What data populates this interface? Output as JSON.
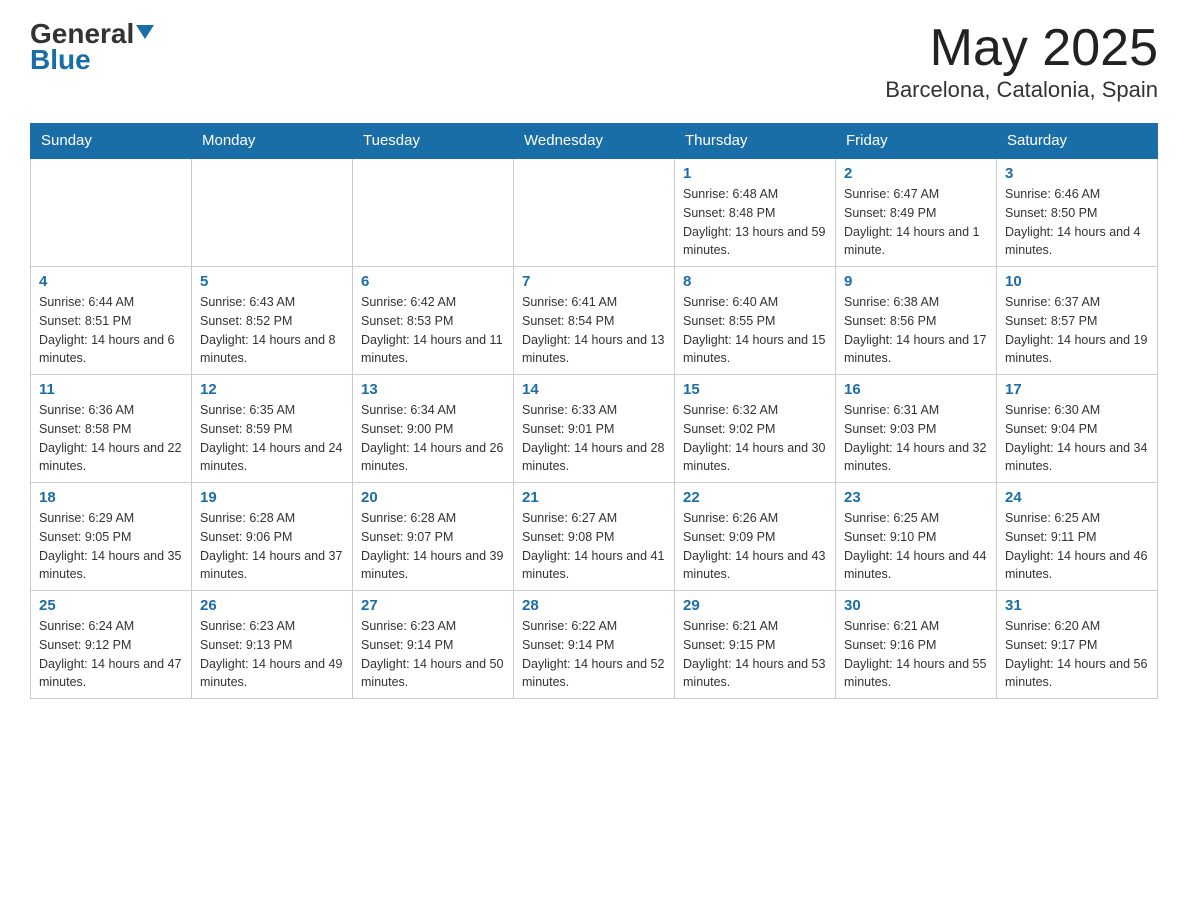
{
  "header": {
    "logo_general": "General",
    "logo_blue": "Blue",
    "title": "May 2025",
    "subtitle": "Barcelona, Catalonia, Spain"
  },
  "days_of_week": [
    "Sunday",
    "Monday",
    "Tuesday",
    "Wednesday",
    "Thursday",
    "Friday",
    "Saturday"
  ],
  "weeks": [
    [
      {
        "day": "",
        "info": ""
      },
      {
        "day": "",
        "info": ""
      },
      {
        "day": "",
        "info": ""
      },
      {
        "day": "",
        "info": ""
      },
      {
        "day": "1",
        "info": "Sunrise: 6:48 AM\nSunset: 8:48 PM\nDaylight: 13 hours and 59 minutes."
      },
      {
        "day": "2",
        "info": "Sunrise: 6:47 AM\nSunset: 8:49 PM\nDaylight: 14 hours and 1 minute."
      },
      {
        "day": "3",
        "info": "Sunrise: 6:46 AM\nSunset: 8:50 PM\nDaylight: 14 hours and 4 minutes."
      }
    ],
    [
      {
        "day": "4",
        "info": "Sunrise: 6:44 AM\nSunset: 8:51 PM\nDaylight: 14 hours and 6 minutes."
      },
      {
        "day": "5",
        "info": "Sunrise: 6:43 AM\nSunset: 8:52 PM\nDaylight: 14 hours and 8 minutes."
      },
      {
        "day": "6",
        "info": "Sunrise: 6:42 AM\nSunset: 8:53 PM\nDaylight: 14 hours and 11 minutes."
      },
      {
        "day": "7",
        "info": "Sunrise: 6:41 AM\nSunset: 8:54 PM\nDaylight: 14 hours and 13 minutes."
      },
      {
        "day": "8",
        "info": "Sunrise: 6:40 AM\nSunset: 8:55 PM\nDaylight: 14 hours and 15 minutes."
      },
      {
        "day": "9",
        "info": "Sunrise: 6:38 AM\nSunset: 8:56 PM\nDaylight: 14 hours and 17 minutes."
      },
      {
        "day": "10",
        "info": "Sunrise: 6:37 AM\nSunset: 8:57 PM\nDaylight: 14 hours and 19 minutes."
      }
    ],
    [
      {
        "day": "11",
        "info": "Sunrise: 6:36 AM\nSunset: 8:58 PM\nDaylight: 14 hours and 22 minutes."
      },
      {
        "day": "12",
        "info": "Sunrise: 6:35 AM\nSunset: 8:59 PM\nDaylight: 14 hours and 24 minutes."
      },
      {
        "day": "13",
        "info": "Sunrise: 6:34 AM\nSunset: 9:00 PM\nDaylight: 14 hours and 26 minutes."
      },
      {
        "day": "14",
        "info": "Sunrise: 6:33 AM\nSunset: 9:01 PM\nDaylight: 14 hours and 28 minutes."
      },
      {
        "day": "15",
        "info": "Sunrise: 6:32 AM\nSunset: 9:02 PM\nDaylight: 14 hours and 30 minutes."
      },
      {
        "day": "16",
        "info": "Sunrise: 6:31 AM\nSunset: 9:03 PM\nDaylight: 14 hours and 32 minutes."
      },
      {
        "day": "17",
        "info": "Sunrise: 6:30 AM\nSunset: 9:04 PM\nDaylight: 14 hours and 34 minutes."
      }
    ],
    [
      {
        "day": "18",
        "info": "Sunrise: 6:29 AM\nSunset: 9:05 PM\nDaylight: 14 hours and 35 minutes."
      },
      {
        "day": "19",
        "info": "Sunrise: 6:28 AM\nSunset: 9:06 PM\nDaylight: 14 hours and 37 minutes."
      },
      {
        "day": "20",
        "info": "Sunrise: 6:28 AM\nSunset: 9:07 PM\nDaylight: 14 hours and 39 minutes."
      },
      {
        "day": "21",
        "info": "Sunrise: 6:27 AM\nSunset: 9:08 PM\nDaylight: 14 hours and 41 minutes."
      },
      {
        "day": "22",
        "info": "Sunrise: 6:26 AM\nSunset: 9:09 PM\nDaylight: 14 hours and 43 minutes."
      },
      {
        "day": "23",
        "info": "Sunrise: 6:25 AM\nSunset: 9:10 PM\nDaylight: 14 hours and 44 minutes."
      },
      {
        "day": "24",
        "info": "Sunrise: 6:25 AM\nSunset: 9:11 PM\nDaylight: 14 hours and 46 minutes."
      }
    ],
    [
      {
        "day": "25",
        "info": "Sunrise: 6:24 AM\nSunset: 9:12 PM\nDaylight: 14 hours and 47 minutes."
      },
      {
        "day": "26",
        "info": "Sunrise: 6:23 AM\nSunset: 9:13 PM\nDaylight: 14 hours and 49 minutes."
      },
      {
        "day": "27",
        "info": "Sunrise: 6:23 AM\nSunset: 9:14 PM\nDaylight: 14 hours and 50 minutes."
      },
      {
        "day": "28",
        "info": "Sunrise: 6:22 AM\nSunset: 9:14 PM\nDaylight: 14 hours and 52 minutes."
      },
      {
        "day": "29",
        "info": "Sunrise: 6:21 AM\nSunset: 9:15 PM\nDaylight: 14 hours and 53 minutes."
      },
      {
        "day": "30",
        "info": "Sunrise: 6:21 AM\nSunset: 9:16 PM\nDaylight: 14 hours and 55 minutes."
      },
      {
        "day": "31",
        "info": "Sunrise: 6:20 AM\nSunset: 9:17 PM\nDaylight: 14 hours and 56 minutes."
      }
    ]
  ]
}
